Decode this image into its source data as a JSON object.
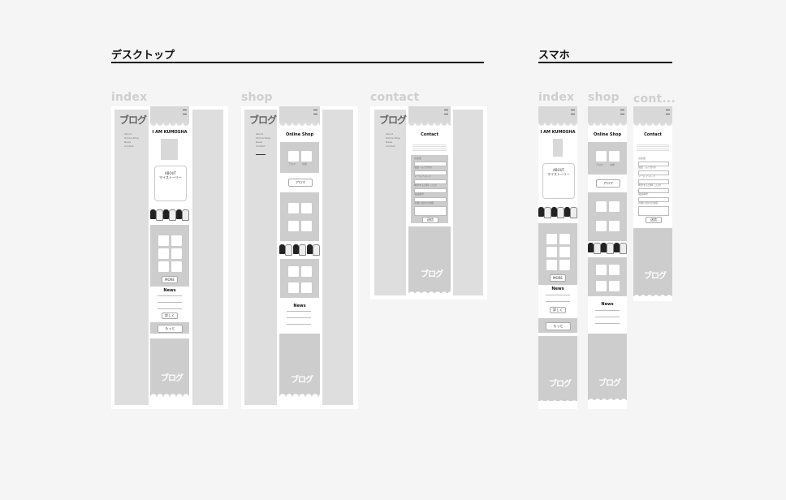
{
  "sections": {
    "desktop": "デスクトップ",
    "mobile": "スマホ"
  },
  "pages": {
    "index": "index",
    "shop": "shop",
    "contact": "contact",
    "contact_short": "cont..."
  },
  "site": {
    "logo": "ブログ",
    "nav": [
      "About",
      "Online Shop",
      "News",
      "Contact"
    ],
    "hero_title": "I AM KUMOSHA",
    "speech_text": "ABOUT",
    "speech_sub": "マイストーリー",
    "news_title": "News",
    "shop_title": "Online Shop",
    "contact_title": "Contact",
    "more_button": "MORE",
    "detail_button": "詳しく",
    "more_jp": "もっと",
    "submit_button": "送信",
    "cat_a": "アロマ",
    "cat_b": "お香",
    "product": "アロマ",
    "product_b": "お香セット",
    "form_labels": [
      "お名前",
      "電話（ふりがな）",
      "メールアドレス",
      "希望する日時（入力）",
      "電話番号",
      "お問い合わせ内容"
    ]
  },
  "colors": {
    "background": "#f5f5f5",
    "panel": "#dedede",
    "accent": "#111111"
  }
}
